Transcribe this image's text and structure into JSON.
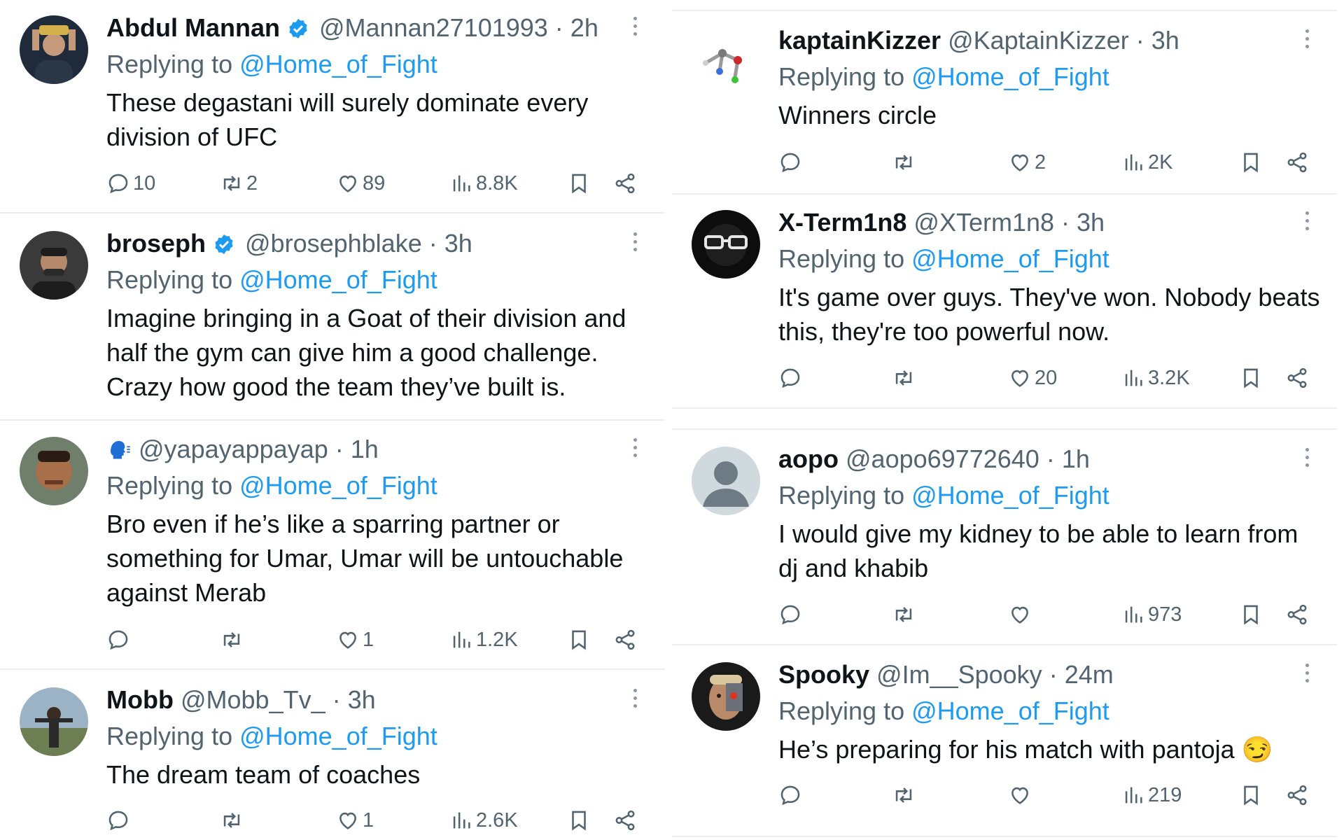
{
  "replying_prefix": "Replying to ",
  "columns": {
    "left": [
      {
        "name": "Abdul Mannan",
        "verified": true,
        "handle": "@Mannan27101993",
        "time": "2h",
        "replying_to": "@Home_of_Fight",
        "text": "These degastani will surely dominate every division of UFC",
        "stats": {
          "replies": "10",
          "retweets": "2",
          "likes": "89",
          "views": "8.8K"
        }
      },
      {
        "name": "broseph",
        "verified": true,
        "handle": "@brosephblake",
        "time": "3h",
        "replying_to": "@Home_of_Fight",
        "text": "Imagine bringing in a Goat of their division and half the gym can give him a good challenge. Crazy how good the team they’ve built is.",
        "stats": {
          "replies": "",
          "retweets": "",
          "likes": "",
          "views": ""
        }
      },
      {
        "name": "",
        "name_emoji": "speaking-head-icon",
        "verified": false,
        "handle": "@yapayappayap",
        "time": "1h",
        "replying_to": "@Home_of_Fight",
        "text": "Bro even if he’s like a sparring partner or something for Umar, Umar will be untouchable against Merab",
        "stats": {
          "replies": "",
          "retweets": "",
          "likes": "1",
          "views": "1.2K"
        }
      },
      {
        "name": "Mobb",
        "verified": false,
        "handle": "@Mobb_Tv_",
        "time": "3h",
        "replying_to": "@Home_of_Fight",
        "text": "The dream team of coaches",
        "stats": {
          "replies": "",
          "retweets": "",
          "likes": "1",
          "views": "2.6K"
        }
      }
    ],
    "right": [
      {
        "name": "kaptainKizzer",
        "verified": false,
        "handle": "@KaptainKizzer",
        "time": "3h",
        "replying_to": "@Home_of_Fight",
        "text": "Winners circle",
        "stats": {
          "replies": "",
          "retweets": "",
          "likes": "2",
          "views": "2K"
        }
      },
      {
        "name": "X-Term1n8",
        "verified": false,
        "handle": "@XTerm1n8",
        "time": "3h",
        "replying_to": "@Home_of_Fight",
        "text": "It's game over guys. They've won. Nobody beats this, they're too powerful now.",
        "stats": {
          "replies": "",
          "retweets": "",
          "likes": "20",
          "views": "3.2K"
        }
      },
      {
        "name": "aopo",
        "verified": false,
        "handle": "@aopo69772640",
        "time": "1h",
        "replying_to": "@Home_of_Fight",
        "text": "I would give my kidney to be able to learn from dj and khabib",
        "stats": {
          "replies": "",
          "retweets": "",
          "likes": "",
          "views": "973"
        }
      },
      {
        "name": "Spooky",
        "verified": false,
        "handle": "@Im__Spooky",
        "time": "24m",
        "replying_to": "@Home_of_Fight",
        "text": "He’s preparing for his match with pantoja 😏",
        "stats": {
          "replies": "",
          "retweets": "",
          "likes": "",
          "views": "219"
        }
      }
    ]
  },
  "colors": {
    "text": "#0f1419",
    "secondary": "#536471",
    "link": "#1d9bf0",
    "verified": "#1d9bf0",
    "separator": "#eceef0"
  },
  "icons": [
    "reply-icon",
    "retweet-icon",
    "like-icon",
    "views-icon",
    "bookmark-icon",
    "share-icon",
    "more-icon",
    "verified-badge-icon"
  ]
}
